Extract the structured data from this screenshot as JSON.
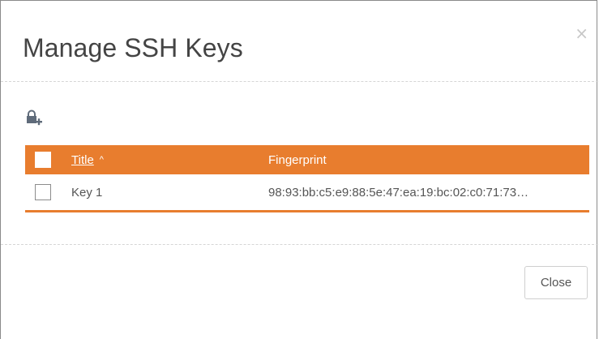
{
  "dialog": {
    "title": "Manage SSH Keys",
    "close_glyph": "×",
    "close_button_label": "Close"
  },
  "toolbar": {
    "add_key_icon": "add-key-icon"
  },
  "table": {
    "columns": {
      "title": "Title",
      "sort_indicator": "^",
      "fingerprint": "Fingerprint"
    },
    "rows": [
      {
        "title": "Key 1",
        "fingerprint": "98:93:bb:c5:e9:88:5e:47:ea:19:bc:02:c0:71:73…",
        "selected": false
      }
    ]
  },
  "colors": {
    "accent": "#e87d2e",
    "title_text": "#444444",
    "body_text": "#555555"
  }
}
